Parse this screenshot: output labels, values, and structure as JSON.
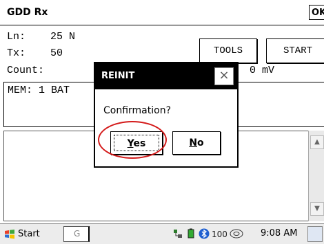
{
  "window": {
    "title": "GDD Rx",
    "ok_label": "OK"
  },
  "status": {
    "ln_label": "Ln:",
    "ln_value": "25 N",
    "tx_label": "Tx:",
    "tx_value": "50",
    "count_label": "Count:",
    "mv_readout": "0 mV",
    "mem_text": "MEM: 1 BAT"
  },
  "toolbar": {
    "tools_label": "TOOLS",
    "start_label": "START"
  },
  "dialog": {
    "title": "REINIT",
    "close_glyph": "×",
    "message": "Confirmation?",
    "yes_label_accel": "Y",
    "yes_label_rest": "es",
    "no_label_accel": "N",
    "no_label_rest": "o"
  },
  "scroll": {
    "up_glyph": "▲",
    "down_glyph": "▼"
  },
  "taskbar": {
    "start_label": "Start",
    "task_label": "G",
    "clock": "9:08 AM",
    "tray_icons": [
      "connectivity-icon",
      "battery-icon",
      "bluetooth-icon",
      "network-icon",
      "wifi-icon"
    ]
  },
  "colors": {
    "highlight": "#d41a1a",
    "dialog_titlebar": "#000000",
    "taskbar": "#ececec"
  }
}
